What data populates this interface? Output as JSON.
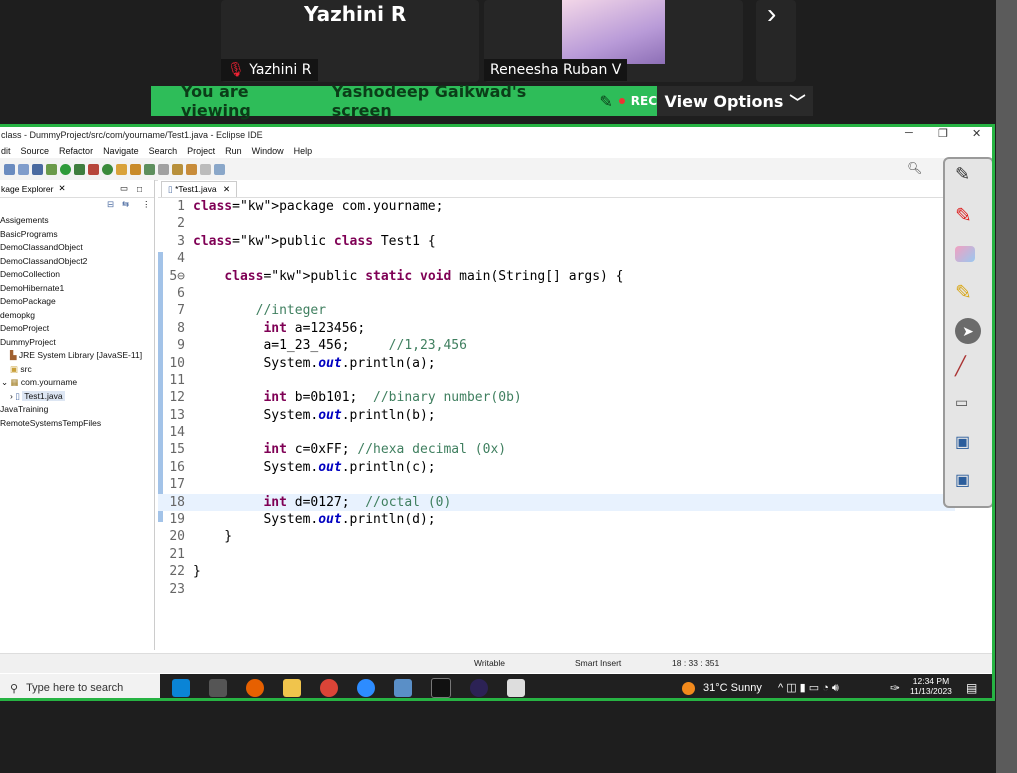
{
  "zoom": {
    "participant1_name_large": "Yazhini R",
    "participant1_label": "Yazhini R",
    "participant2_label": "Reneesha Ruban V",
    "banner_prefix": "You are viewing",
    "banner_name": "Yashodeep Gaikwad's screen",
    "rec": "REC",
    "view_options": "View Options",
    "next_icon": "chevron-right-icon"
  },
  "ide": {
    "title": "class - DummyProject/src/com/yourname/Test1.java - Eclipse IDE",
    "menu": [
      "dit",
      "Source",
      "Refactor",
      "Navigate",
      "Search",
      "Project",
      "Run",
      "Window",
      "Help"
    ],
    "explorer_title": "kage Explorer",
    "tree": [
      "Assigements",
      "BasicPrograms",
      "DemoClassandObject",
      "DemoClassandObject2",
      "DemoCollection",
      "DemoHibernate1",
      "DemoPackage",
      "demopkg",
      "DemoProject",
      "DummyProject",
      "JRE System Library [JavaSE-11]",
      "src",
      "com.yourname",
      "Test1.java",
      "JavaTraining",
      "RemoteSystemsTempFiles"
    ],
    "editor_tab": "*Test1.java",
    "code_lines": [
      {
        "n": "1",
        "t": "package com.yourname;"
      },
      {
        "n": "2",
        "t": ""
      },
      {
        "n": "3",
        "t": "public class Test1 {"
      },
      {
        "n": "4",
        "t": ""
      },
      {
        "n": "5⊖",
        "t": "    public static void main(String[] args) {"
      },
      {
        "n": "6",
        "t": ""
      },
      {
        "n": "7",
        "t": "        //integer"
      },
      {
        "n": "8",
        "t": "         int a=123456;"
      },
      {
        "n": "9",
        "t": "         a=1_23_456;     //1,23,456"
      },
      {
        "n": "10",
        "t": "         System.out.println(a);"
      },
      {
        "n": "11",
        "t": ""
      },
      {
        "n": "12",
        "t": "         int b=0b101;  //binary number(0b)"
      },
      {
        "n": "13",
        "t": "         System.out.println(b);"
      },
      {
        "n": "14",
        "t": ""
      },
      {
        "n": "15",
        "t": "         int c=0xFF; //hexa decimal (0x)"
      },
      {
        "n": "16",
        "t": "         System.out.println(c);"
      },
      {
        "n": "17",
        "t": ""
      },
      {
        "n": "18",
        "t": "         int d=0127;  //octal (0)"
      },
      {
        "n": "19",
        "t": "         System.out.println(d);"
      },
      {
        "n": "20",
        "t": "    }"
      },
      {
        "n": "21",
        "t": ""
      },
      {
        "n": "22",
        "t": "}"
      },
      {
        "n": "23",
        "t": ""
      }
    ],
    "status": {
      "writable": "Writable",
      "insert": "Smart Insert",
      "position": "18 : 33 : 351"
    }
  },
  "taskbar": {
    "search_placeholder": "Type here to search",
    "weather": "31°C  Sunny",
    "time": "12:34 PM",
    "date": "11/13/2023"
  }
}
